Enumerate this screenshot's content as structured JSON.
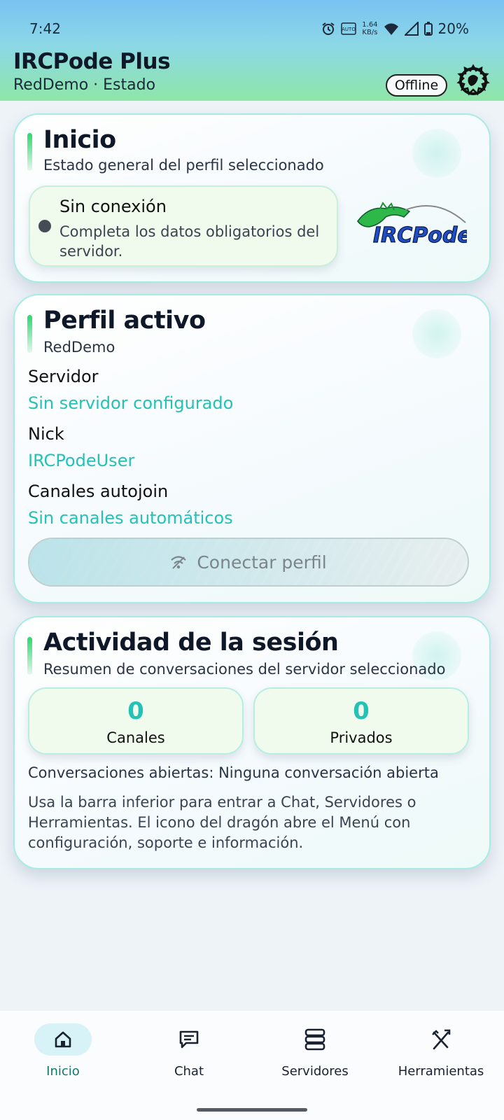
{
  "status_bar": {
    "time": "7:42",
    "speed_value": "1.64",
    "speed_unit": "KB/s",
    "battery": "20%",
    "icons": [
      "alarm-icon",
      "auto-icon",
      "wifi-icon",
      "signal-icon",
      "battery-icon"
    ]
  },
  "header": {
    "title": "IRCPode Plus",
    "subtitle": "RedDemo · Estado",
    "status_pill": "Offline",
    "menu_icon": "dragon-icon"
  },
  "inicio": {
    "title": "Inicio",
    "subtitle": "Estado general del perfil seleccionado",
    "connection": {
      "title": "Sin conexión",
      "description": "Completa los datos obligatorios del servidor."
    },
    "logo_text": "IRCPode"
  },
  "perfil": {
    "title": "Perfil activo",
    "subtitle": "RedDemo",
    "fields": [
      {
        "label": "Servidor",
        "value": "Sin servidor configurado"
      },
      {
        "label": "Nick",
        "value": "IRCPodeUser"
      },
      {
        "label": "Canales autojoin",
        "value": "Sin canales automáticos"
      }
    ],
    "connect_button": "Conectar perfil"
  },
  "actividad": {
    "title": "Actividad de la sesión",
    "subtitle": "Resumen de conversaciones del servidor seleccionado",
    "stats": [
      {
        "value": "0",
        "label": "Canales"
      },
      {
        "value": "0",
        "label": "Privados"
      }
    ],
    "open_conversations": "Conversaciones abiertas: Ninguna conversación abierta",
    "help": "Usa la barra inferior para entrar a Chat, Servidores o Herramientas. El icono del dragón abre el Menú con configuración, soporte e información."
  },
  "bottom_nav": [
    {
      "label": "Inicio",
      "icon": "home-icon",
      "active": true
    },
    {
      "label": "Chat",
      "icon": "chat-icon",
      "active": false
    },
    {
      "label": "Servidores",
      "icon": "servers-icon",
      "active": false
    },
    {
      "label": "Herramientas",
      "icon": "tools-icon",
      "active": false
    }
  ],
  "colors": {
    "accent": "#24c2b6",
    "card_border": "#a7ece4",
    "nav_active": "#0e7a6c"
  }
}
